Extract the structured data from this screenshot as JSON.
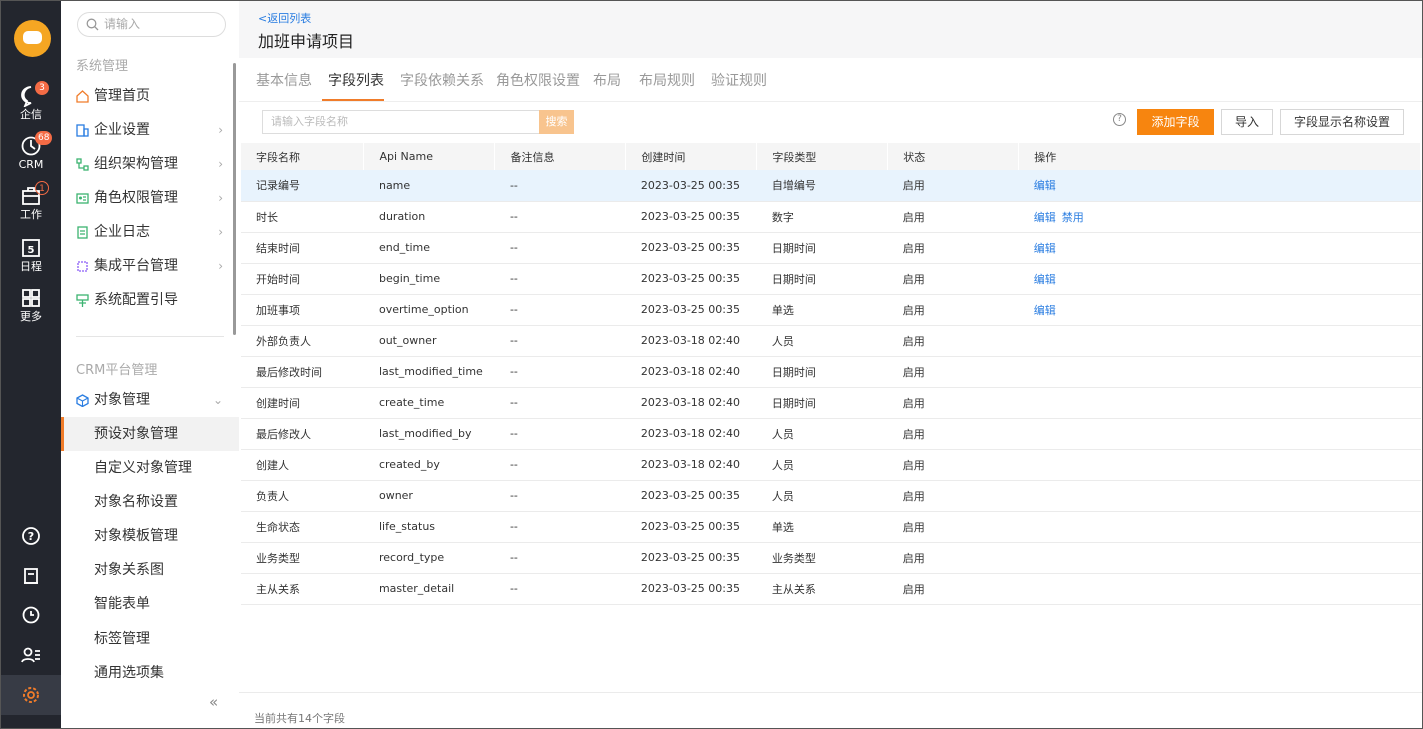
{
  "rail": {
    "items": [
      {
        "label": "企信",
        "badge": "3"
      },
      {
        "label": "CRM",
        "badge": "68"
      },
      {
        "label": "工作",
        "badge": "1"
      },
      {
        "label": "日程",
        "day": "5"
      },
      {
        "label": "更多"
      }
    ]
  },
  "sidebar": {
    "search_placeholder": "请输入",
    "group1": "系统管理",
    "group1_items": [
      {
        "label": "管理首页"
      },
      {
        "label": "企业设置",
        "arrow": "›"
      },
      {
        "label": "组织架构管理",
        "arrow": "›"
      },
      {
        "label": "角色权限管理",
        "arrow": "›"
      },
      {
        "label": "企业日志",
        "arrow": "›"
      },
      {
        "label": "集成平台管理",
        "arrow": "›"
      },
      {
        "label": "系统配置引导"
      }
    ],
    "group2": "CRM平台管理",
    "object_menu": "对象管理",
    "object_arrow": "⌄",
    "sub_items": [
      "预设对象管理",
      "自定义对象管理",
      "对象名称设置",
      "对象模板管理",
      "对象关系图",
      "智能表单",
      "标签管理",
      "通用选项集"
    ],
    "collapse": "«"
  },
  "header": {
    "back": "<返回列表",
    "title": "加班申请项目"
  },
  "tabs": [
    "基本信息",
    "字段列表",
    "字段依赖关系",
    "角色权限设置",
    "布局",
    "布局规则",
    "验证规则"
  ],
  "toolbar": {
    "search_placeholder": "请输入字段名称",
    "search_btn": "搜索",
    "help": "?",
    "add_btn": "添加字段",
    "import_btn": "导入",
    "display_btn": "字段显示名称设置"
  },
  "table": {
    "headers": [
      "字段名称",
      "Api Name",
      "备注信息",
      "创建时间",
      "字段类型",
      "状态",
      "操作"
    ],
    "rows": [
      {
        "name": "记录编号",
        "api": "name",
        "note": "--",
        "time": "2023-03-25 00:35",
        "type": "自增编号",
        "status": "启用",
        "ops": [
          "编辑"
        ]
      },
      {
        "name": "时长",
        "api": "duration",
        "note": "--",
        "time": "2023-03-25 00:35",
        "type": "数字",
        "status": "启用",
        "ops": [
          "编辑",
          "禁用"
        ]
      },
      {
        "name": "结束时间",
        "api": "end_time",
        "note": "--",
        "time": "2023-03-25 00:35",
        "type": "日期时间",
        "status": "启用",
        "ops": [
          "编辑"
        ]
      },
      {
        "name": "开始时间",
        "api": "begin_time",
        "note": "--",
        "time": "2023-03-25 00:35",
        "type": "日期时间",
        "status": "启用",
        "ops": [
          "编辑"
        ]
      },
      {
        "name": "加班事项",
        "api": "overtime_option",
        "note": "--",
        "time": "2023-03-25 00:35",
        "type": "单选",
        "status": "启用",
        "ops": [
          "编辑"
        ]
      },
      {
        "name": "外部负责人",
        "api": "out_owner",
        "note": "--",
        "time": "2023-03-18 02:40",
        "type": "人员",
        "status": "启用",
        "ops": []
      },
      {
        "name": "最后修改时间",
        "api": "last_modified_time",
        "note": "--",
        "time": "2023-03-18 02:40",
        "type": "日期时间",
        "status": "启用",
        "ops": []
      },
      {
        "name": "创建时间",
        "api": "create_time",
        "note": "--",
        "time": "2023-03-18 02:40",
        "type": "日期时间",
        "status": "启用",
        "ops": []
      },
      {
        "name": "最后修改人",
        "api": "last_modified_by",
        "note": "--",
        "time": "2023-03-18 02:40",
        "type": "人员",
        "status": "启用",
        "ops": []
      },
      {
        "name": "创建人",
        "api": "created_by",
        "note": "--",
        "time": "2023-03-18 02:40",
        "type": "人员",
        "status": "启用",
        "ops": []
      },
      {
        "name": "负责人",
        "api": "owner",
        "note": "--",
        "time": "2023-03-25 00:35",
        "type": "人员",
        "status": "启用",
        "ops": []
      },
      {
        "name": "生命状态",
        "api": "life_status",
        "note": "--",
        "time": "2023-03-25 00:35",
        "type": "单选",
        "status": "启用",
        "ops": []
      },
      {
        "name": "业务类型",
        "api": "record_type",
        "note": "--",
        "time": "2023-03-25 00:35",
        "type": "业务类型",
        "status": "启用",
        "ops": []
      },
      {
        "name": "主从关系",
        "api": "master_detail",
        "note": "--",
        "time": "2023-03-25 00:35",
        "type": "主从关系",
        "status": "启用",
        "ops": []
      }
    ]
  },
  "footer": {
    "count": "当前共有14个字段"
  },
  "colors": {
    "accent": "#f7850f",
    "link": "#2a7de1",
    "rail": "#23262e"
  }
}
